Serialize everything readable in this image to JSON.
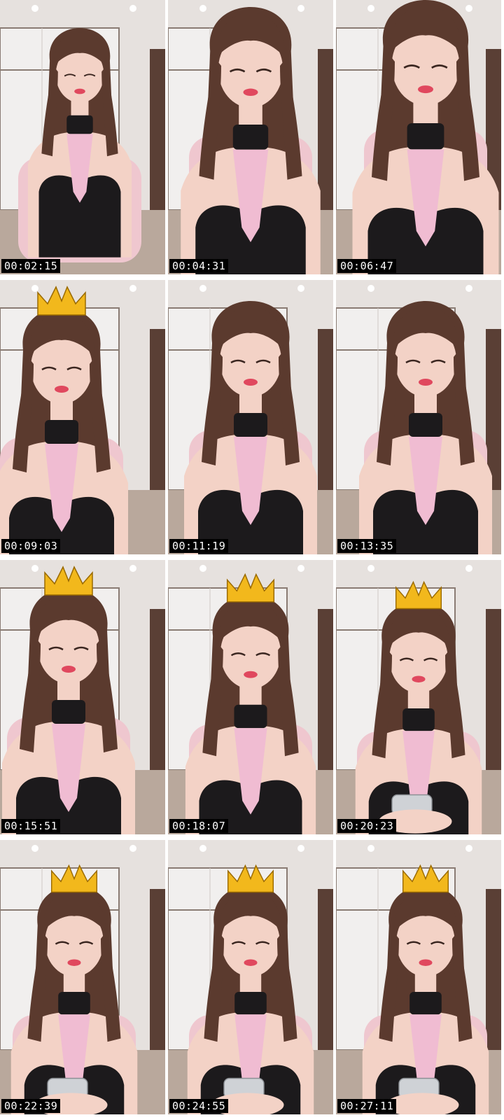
{
  "contact_sheet": {
    "frames": [
      {
        "timestamp": "00:02:15",
        "crown": false,
        "phone": false
      },
      {
        "timestamp": "00:04:31",
        "crown": false,
        "phone": false
      },
      {
        "timestamp": "00:06:47",
        "crown": false,
        "phone": false
      },
      {
        "timestamp": "00:09:03",
        "crown": true,
        "phone": false
      },
      {
        "timestamp": "00:11:19",
        "crown": false,
        "phone": false
      },
      {
        "timestamp": "00:13:35",
        "crown": false,
        "phone": false
      },
      {
        "timestamp": "00:15:51",
        "crown": true,
        "phone": false
      },
      {
        "timestamp": "00:18:07",
        "crown": true,
        "phone": false
      },
      {
        "timestamp": "00:20:23",
        "crown": true,
        "phone": true
      },
      {
        "timestamp": "00:22:39",
        "crown": true,
        "phone": true
      },
      {
        "timestamp": "00:24:55",
        "crown": true,
        "phone": true
      },
      {
        "timestamp": "00:27:11",
        "crown": true,
        "phone": true
      }
    ]
  },
  "colors": {
    "wall": "#e6e1de",
    "cabinet": "#f1efee",
    "hair": "#5b3a2e",
    "skin": "#f3d2c6",
    "outfit_black": "#1c1a1c",
    "outfit_pink": "#f0bcd2",
    "chair_pink": "#efc7cf",
    "crown_gold": "#f2b81c",
    "timestamp_bg": "#000000",
    "timestamp_text": "#ffffff"
  }
}
